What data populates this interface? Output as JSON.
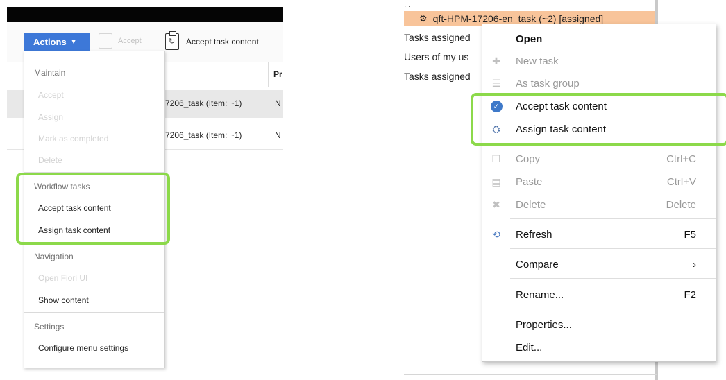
{
  "left": {
    "toolbar": {
      "actions_label": "Actions",
      "accept_label": "Accept",
      "accept_task_content_label": "Accept task content"
    },
    "table": {
      "col_header_partial": "Pr",
      "rows": [
        {
          "title": "7206_task (Item: ~1)",
          "status": "N"
        },
        {
          "title": "7206_task (Item: ~1)",
          "status": "N"
        }
      ]
    },
    "menu": {
      "sections": [
        {
          "title": "Maintain",
          "items": [
            {
              "label": "Accept",
              "disabled": true
            },
            {
              "label": "Assign",
              "disabled": true
            },
            {
              "label": "Mark as completed",
              "disabled": true
            },
            {
              "label": "Delete",
              "disabled": true
            }
          ]
        },
        {
          "title": "Workflow tasks",
          "items": [
            {
              "label": "Accept task content",
              "disabled": false
            },
            {
              "label": "Assign task content",
              "disabled": false
            }
          ]
        },
        {
          "title": "Navigation",
          "items": [
            {
              "label": "Open Fiori UI",
              "disabled": true
            },
            {
              "label": "Show content",
              "disabled": false
            }
          ]
        },
        {
          "title": "Settings",
          "items": [
            {
              "label": "Configure menu settings",
              "disabled": false
            }
          ]
        }
      ]
    }
  },
  "right": {
    "tree": {
      "selected_node": "qft-HPM-17206-en_task (~2) [assigned]",
      "rows": [
        "Tasks assigned",
        "Users of my us",
        "Tasks assigned"
      ]
    },
    "context_menu": [
      {
        "label": "Open",
        "shortcut": "",
        "icon": "none",
        "disabled": false,
        "bold": true
      },
      {
        "label": "New task",
        "shortcut": "",
        "icon": "plus-icon",
        "disabled": true
      },
      {
        "label": "As task group",
        "shortcut": "",
        "icon": "list-icon",
        "disabled": true
      },
      {
        "label": "Accept task content",
        "shortcut": "",
        "icon": "check-circle-icon",
        "disabled": false
      },
      {
        "label": "Assign task content",
        "shortcut": "",
        "icon": "assign-icon",
        "disabled": false
      },
      {
        "label": "Copy",
        "shortcut": "Ctrl+C",
        "icon": "copy-icon",
        "disabled": true
      },
      {
        "label": "Paste",
        "shortcut": "Ctrl+V",
        "icon": "paste-icon",
        "disabled": true
      },
      {
        "label": "Delete",
        "shortcut": "Delete",
        "icon": "delete-icon",
        "disabled": true
      },
      {
        "label": "Refresh",
        "shortcut": "F5",
        "icon": "refresh-icon",
        "disabled": false
      },
      {
        "label": "Compare",
        "shortcut": "›",
        "icon": "none",
        "disabled": false
      },
      {
        "label": "Rename...",
        "shortcut": "F2",
        "icon": "none",
        "disabled": false
      },
      {
        "label": "Properties...",
        "shortcut": "",
        "icon": "none",
        "disabled": false
      },
      {
        "label": "Edit...",
        "shortcut": "",
        "icon": "none",
        "disabled": false
      }
    ]
  },
  "colors": {
    "actions_button": "#3d78d8",
    "highlight_border": "#8cd94a",
    "selected_node_bg": "#f8c49a",
    "check_icon": "#3e79c9"
  }
}
